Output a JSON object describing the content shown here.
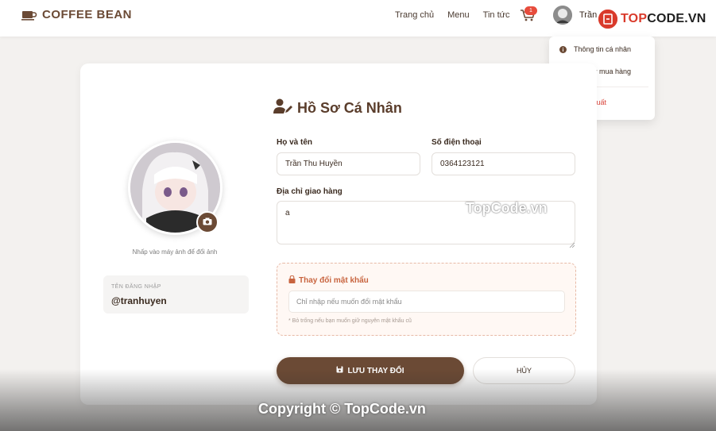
{
  "brand": {
    "name": "COFFEE BEAN"
  },
  "nav": {
    "items": [
      "Trang chủ",
      "Menu",
      "Tin tức"
    ]
  },
  "cart": {
    "count": "1"
  },
  "user": {
    "name_visible": "Trần"
  },
  "dropdown": {
    "profile": "Thông tin cá nhân",
    "history": "Lịch sử mua hàng",
    "logout": "Đăng xuất"
  },
  "profile": {
    "title": "Hồ Sơ Cá Nhân",
    "avatar_hint": "Nhấp vào máy ảnh để đổi ảnh",
    "login_label": "TÊN ĐĂNG NHẬP",
    "username": "@tranhuyen"
  },
  "form": {
    "fullname_label": "Họ và tên",
    "fullname_value": "Trần Thu Huyền",
    "phone_label": "Số điện thoại",
    "phone_value": "0364123121",
    "address_label": "Địa chỉ giao hàng",
    "address_value": "a"
  },
  "password": {
    "title": "Thay đổi mật khẩu",
    "placeholder": "Chỉ nhập nếu muốn đổi mật khẩu",
    "note": "* Bỏ trống nếu bạn muốn giữ nguyên mật khẩu cũ"
  },
  "actions": {
    "save": "LƯU THAY ĐỔI",
    "cancel": "HỦY"
  },
  "watermark": {
    "logo_top": "TOP",
    "logo_rest": "CODE.VN",
    "center": "TopCode.vn",
    "bottom": "Copyright © TopCode.vn"
  },
  "colors": {
    "brand_brown": "#6b4a35",
    "accent_orange": "#c8643f",
    "danger": "#d9433a"
  }
}
